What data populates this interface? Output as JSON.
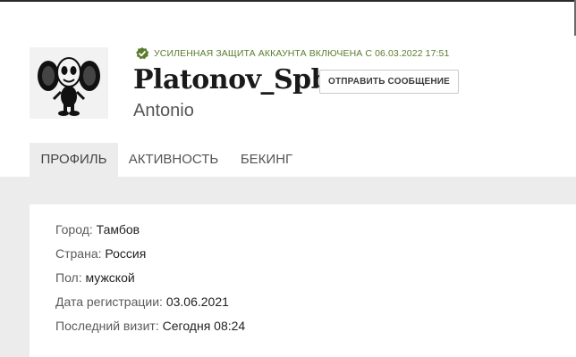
{
  "profile": {
    "security_notice": "УСИЛЕННАЯ ЗАЩИТА АККАУНТА ВКЛЮЧЕНА С 06.03.2022  17:51",
    "username": "Platonov_Spb",
    "real_name": "Antonio",
    "send_message_label": "ОТПРАВИТЬ СООБЩЕНИЕ"
  },
  "tabs": [
    {
      "label": "ПРОФИЛЬ",
      "active": true
    },
    {
      "label": "АКТИВНОСТЬ",
      "active": false
    },
    {
      "label": "БЕКИНГ",
      "active": false
    }
  ],
  "details": [
    {
      "key": "Город:",
      "value": "Тамбов"
    },
    {
      "key": "Страна:",
      "value": "Россия"
    },
    {
      "key": "Пол:",
      "value": "мужской"
    },
    {
      "key": "Дата регистрации:",
      "value": "03.06.2021"
    },
    {
      "key": "Последний визит:",
      "value": "Сегодня 08:24"
    }
  ],
  "colors": {
    "security_green": "#5a7c2e",
    "tab_active_bg": "#ececec",
    "content_bg": "#ececec"
  },
  "icons": {
    "security": "shield-check-icon",
    "avatar": "cartoon-character-avatar"
  }
}
